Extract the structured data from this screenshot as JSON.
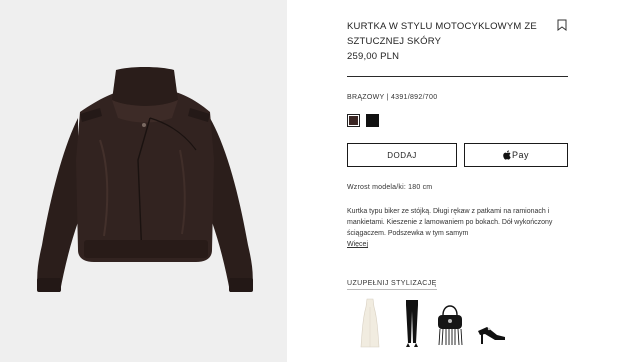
{
  "product": {
    "title": "KURTKA W STYLU MOTOCYKLOWYM ZE SZTUCZNEJ SKÓRY",
    "price": "259,00 PLN",
    "color_ref": "BRĄZOWY | 4391/892/700",
    "swatches": [
      {
        "name": "brązowy",
        "color": "#3a2623",
        "selected": true
      },
      {
        "name": "czarny",
        "color": "#111111",
        "selected": false
      }
    ],
    "add_label": "DODAJ",
    "pay_label": "Pay",
    "model_height": "Wzrost modela/ki: 180 cm",
    "description": "Kurtka typu biker ze stójką. Długi rękaw z patkami na ramionach i mankietami. Kieszenie z lamowaniem po bokach. Dół wykończony ściągaczem. Podszewka w tym samym",
    "more_label": "Więcej"
  },
  "complete_look": {
    "title": "UZUPEŁNIJ STYLIZACJĘ",
    "items": [
      {
        "name": "white-dress"
      },
      {
        "name": "black-leggings"
      },
      {
        "name": "fringe-bag"
      },
      {
        "name": "heeled-sandals"
      }
    ]
  },
  "colors": {
    "jacket": "#2e201d",
    "panel_bg": "#efefef",
    "text": "#222222"
  }
}
